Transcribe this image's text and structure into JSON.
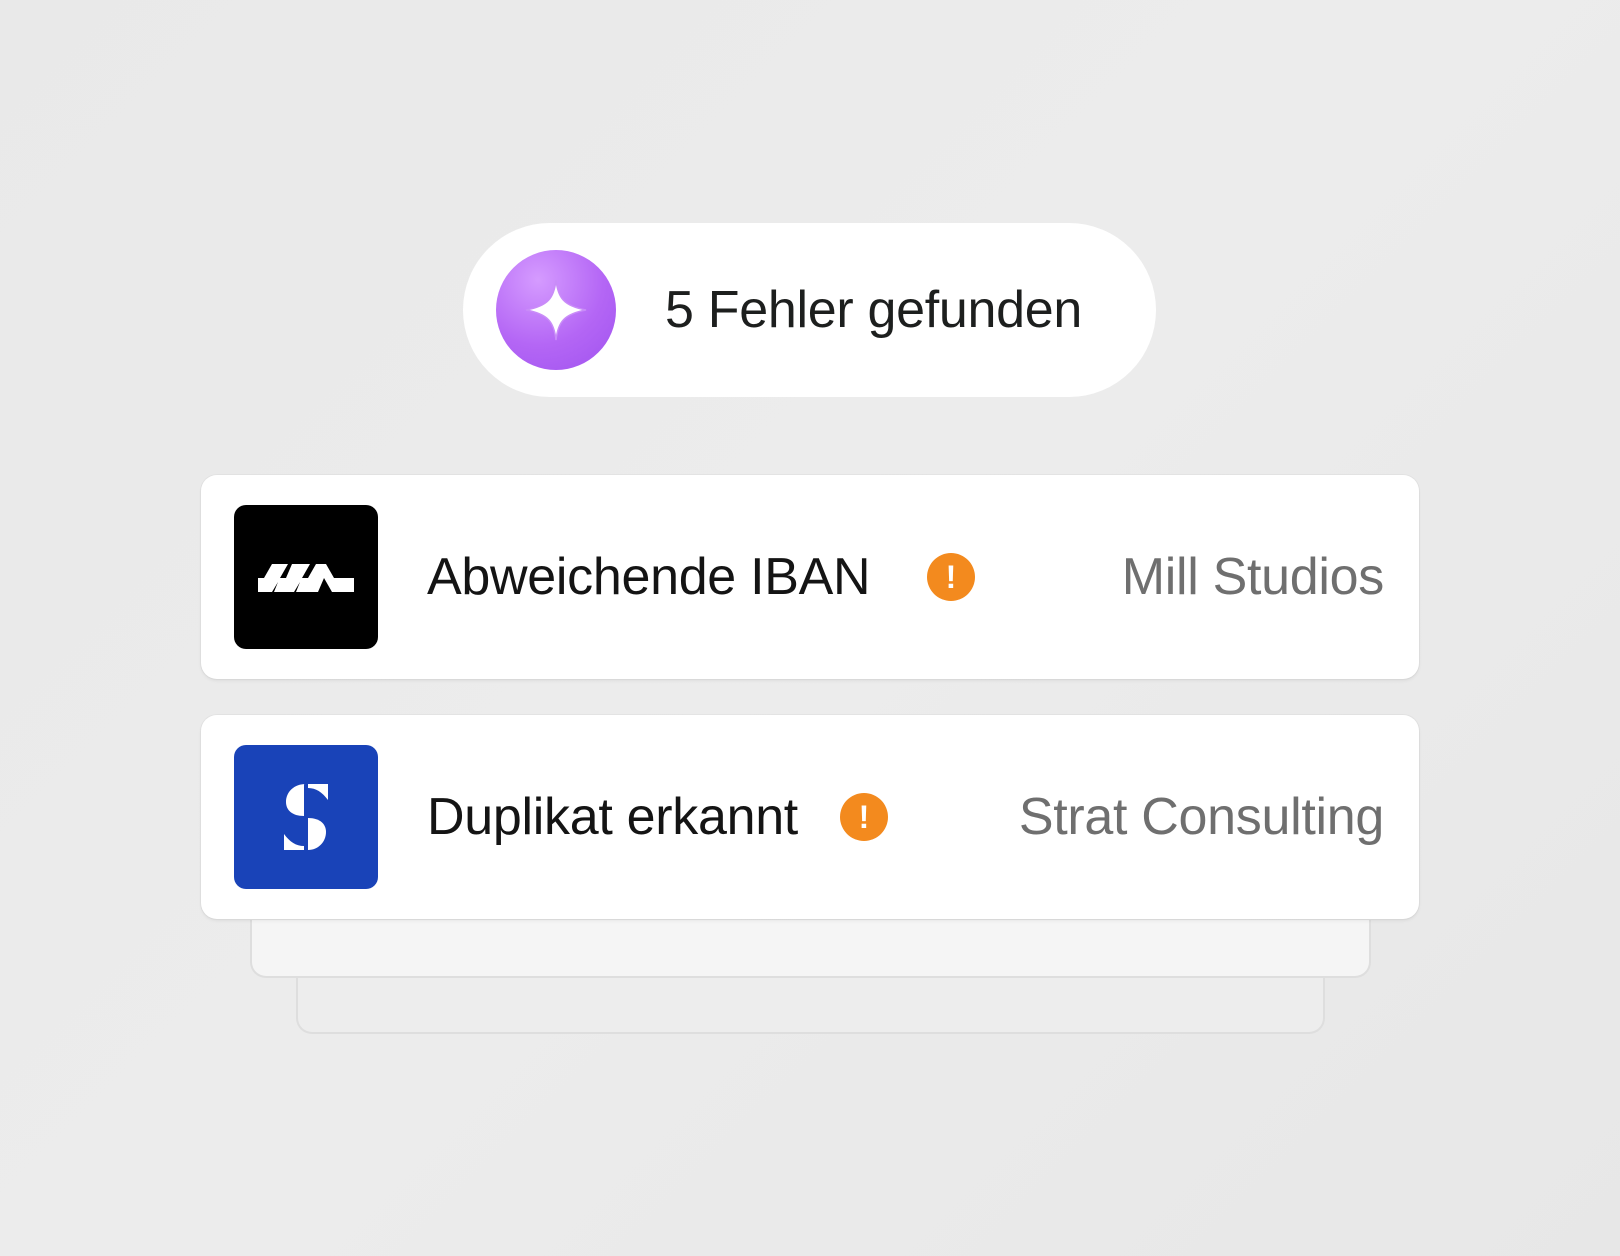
{
  "status": {
    "icon": "sparkle-icon",
    "text": "5 Fehler gefunden"
  },
  "issues": [
    {
      "logo": "mill-studios-logo",
      "title": "Abweichende IBAN",
      "warning_icon": "exclamation-icon",
      "warning_symbol": "!",
      "company": "Mill Studios"
    },
    {
      "logo": "strat-consulting-logo",
      "title": "Duplikat erkannt",
      "warning_icon": "exclamation-icon",
      "warning_symbol": "!",
      "company": "Strat Consulting"
    }
  ],
  "colors": {
    "accent_purple": "#b466f5",
    "warning_orange": "#f38a1e",
    "mill_logo_bg": "#000000",
    "strat_logo_bg": "#1943b8",
    "company_text": "#6f6f6f"
  }
}
